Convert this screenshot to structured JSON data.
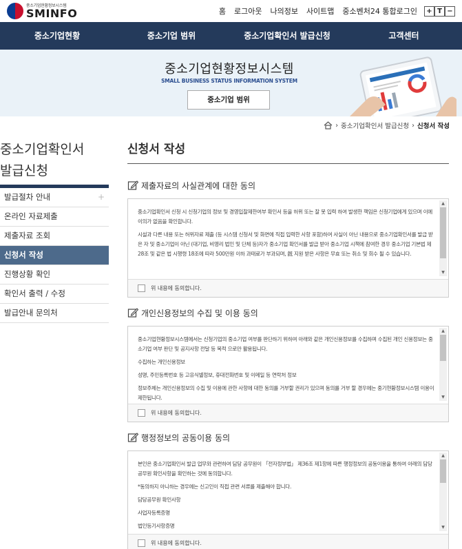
{
  "header": {
    "logo_sub": "중소기업현황정보시스템",
    "logo_main": "SMINFO",
    "util_links": [
      "홈",
      "로그아웃",
      "나의정보",
      "사이트맵",
      "중소벤처24 통합로그인"
    ],
    "font_controls": [
      "+",
      "T",
      "−"
    ]
  },
  "nav": {
    "items": [
      "중소기업현황",
      "중소기업 범위",
      "중소기업확인서 발급신청",
      "고객센터"
    ]
  },
  "banner": {
    "title": "중소기업현황정보시스템",
    "subtitle": "SMALL BUSINESS STATUS INFORMATION SYSTEM",
    "button_label": "중소기업 범위"
  },
  "breadcrumb": {
    "items": [
      "중소기업확인서 발급신청",
      "신청서 작성"
    ]
  },
  "sidebar": {
    "title_line1": "중소기업확인서",
    "title_line2": "발급신청",
    "items": [
      {
        "label": "발급절차 안내",
        "plus": "+"
      },
      {
        "label": "온라인 자료제출"
      },
      {
        "label": "제출자료 조회"
      },
      {
        "label": "신청서 작성"
      },
      {
        "label": "진행상황 확인"
      },
      {
        "label": "확인서 출력 / 수정"
      },
      {
        "label": "발급안내 문의처"
      }
    ],
    "active_index": 3
  },
  "content": {
    "title": "신청서 작성",
    "sections": [
      {
        "heading": "제출자료의 사실관계에 대한 동의",
        "paragraphs": [
          "중소기업확인서 신청 시 신청기업의 정보 및 경영입찰제한여부 확인서 등을 허위 또는 잘 못 입력 하여 발생한 책임은 신청기업에게 있으며 이에 이의가 없음을 확인합니다.",
          "시설과 다른 내용 또는 허위자료 제출 (등 시스템 신청서 및 화면에 직접 입력한 사항 포함)하여 사실이 아닌 내용으로 중소기업확인서를 발급 받은 자 및 중소기업이 아닌 (대기업, 비영리 법인 및 단체 등)자가 중소기업 확인서를 발급 받아 중소기업 시책에 참여한 경우 중소기업 기본법 제 28조 및 같은 법 시행령 18조에 따라 500만원 이하 과태료가 부과되며, 旣 지원 받은 사항은 무효 또는 취소 및 회수 될 수 있습니다."
        ],
        "agree_label": "위 내용에 동의합니다."
      },
      {
        "heading": "개인신용정보의 수집 및 이용 동의",
        "paragraphs": [
          "중소기업현황정보시스템에서는 신청기업의 중소기업 여부를 판단하기 위하여 아래와 같은 개인신용정보를 수집하며 수집된 개인 신용정보는 중소기업 여부 판단 및 공지사항 전달 등 목적 으로만 활용됩니다.",
          "수집하는 개인신용정보",
          "성명, 주민등록번호 등 고유식별정보, 휴대전화번호 및 이메일 등 연락처 정보",
          "정보주체는 개인신용정보의 수집 및 이용에 관한 사항에 대한 동의를 거부할 권리가 있으며 동의를 거부 할 경우에는 중기현황정보시스템 이용이 제한됩니다."
        ],
        "agree_label": "위 내용에 동의합니다."
      },
      {
        "heading": "행정정보의 공동이용 동의",
        "paragraphs": [
          "본인은 중소기업확인서 발급 업무와 관련하여 담당 공무원이 「전자정부법」 제36조 제1항에 따른 행정정보의 공동이용을 통하여 아래의 담당 공무원 확인사항을 확인하는 것에 동의합니다.",
          "*동의하지 아니하는 경우에는 신고인이 직접 관련 서류를 제출해야 합니다.",
          "담당공무원 확인사항",
          "사업자등록증명",
          "법인등기사항증명"
        ],
        "agree_label": "위 내용에 동의합니다."
      }
    ]
  },
  "colors": {
    "nav_bg": "#243a5b",
    "banner_bg": "#eaf2f8",
    "sidebar_active": "#4d6a8b"
  }
}
